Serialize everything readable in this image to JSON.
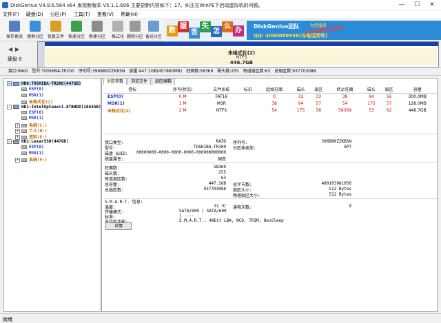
{
  "window": {
    "title": "DiskGenius V4.9.6.564 x64   发现新版本 V5.1.1.696 主要更新内容如下：17、纠正在WinPE下启动虚拟机的问题。",
    "min_glyph": "—",
    "max_glyph": "☐",
    "close_glyph": "✕"
  },
  "menu": [
    "文件(F)",
    "硬盘(D)",
    "分区(P)",
    "工具(T)",
    "查看(V)",
    "帮助(H)"
  ],
  "toolbar": [
    {
      "label": "保存更改",
      "color": "#5a7fc0"
    },
    {
      "label": "搜索分区",
      "color": "#3f8fd8"
    },
    {
      "label": "恢复文件",
      "color": "#d8a028"
    },
    {
      "label": "快速分区",
      "color": "#3aa04a"
    },
    {
      "label": "新建分区",
      "color": "#8c8c8c"
    },
    {
      "label": "格式化",
      "color": "#b0b0b0"
    },
    {
      "label": "删除分区",
      "color": "#9a9a9a"
    },
    {
      "label": "备份分区",
      "color": "#6a9ad0"
    }
  ],
  "banner": {
    "chars": [
      {
        "ch": "数",
        "color": "#e0a010"
      },
      {
        "ch": "据",
        "color": "#d03030"
      },
      {
        "ch": "丢",
        "color": "#3a8fd0"
      },
      {
        "ch": "失",
        "color": "#30a050"
      },
      {
        "ch": "怎",
        "color": "#2c6cc8"
      },
      {
        "ch": "么",
        "color": "#e07018"
      },
      {
        "ch": "办",
        "color": "#c0307a"
      }
    ],
    "brand": "DiskGenius团队",
    "slogan": "为您服务",
    "phone": "400-008-9958",
    "qq": "QQ: 4000089958(与电话同号)"
  },
  "diskmap": {
    "label": "硬盘 0",
    "left_arrow": "◀",
    "right_arrow": "▶",
    "partition_name": "未格式化(2)",
    "partition_fs": "NTFS",
    "partition_size": "446.7GB"
  },
  "infobar": {
    "items": [
      "接口:RAID",
      "型号:TOSHIBA-TR200",
      "序列号:396B80ZZKBSN",
      "容量:447.1GB(457860MB)",
      "柱面数:58369",
      "磁头数:255",
      "每道扇区数:63",
      "总扇区数:937703088"
    ]
  },
  "tree": [
    {
      "text": "HD0:TOSHIBA-TR200(447GB)",
      "type": "disk",
      "color": "",
      "sel": true,
      "exp": "−",
      "indent": 0
    },
    {
      "text": "ESP(0)",
      "type": "part",
      "color": "c-blue",
      "exp": "",
      "indent": 1
    },
    {
      "text": "MSR(1)",
      "type": "part",
      "color": "c-blue",
      "exp": "",
      "indent": 1
    },
    {
      "text": "未格式化(2)",
      "type": "part",
      "color": "c-orange",
      "exp": "",
      "indent": 1
    },
    {
      "text": "HD1:IntelOptane+1.8TBHDD(1863GB)",
      "type": "disk",
      "color": "",
      "exp": "−",
      "indent": 0
    },
    {
      "text": "ESP(0)",
      "type": "part",
      "color": "c-blue",
      "exp": "",
      "indent": 1
    },
    {
      "text": "MSR(1)",
      "type": "part",
      "color": "c-blue",
      "exp": "",
      "indent": 1
    },
    {
      "text": "系统(C:)",
      "type": "part",
      "color": "c-orange",
      "exp": "+",
      "indent": 1
    },
    {
      "text": "个人(H:)",
      "type": "part",
      "color": "c-orange",
      "exp": "+",
      "indent": 1
    },
    {
      "text": "资料(E:)",
      "type": "part",
      "color": "c-orange",
      "exp": "+",
      "indent": 1
    },
    {
      "text": "HD2:LexarSSD(447GB)",
      "type": "disk",
      "color": "",
      "exp": "−",
      "indent": 0
    },
    {
      "text": "ESP(0)",
      "type": "part",
      "color": "c-blue",
      "exp": "",
      "indent": 1
    },
    {
      "text": "MSR(1)",
      "type": "part",
      "color": "c-blue",
      "exp": "",
      "indent": 1
    },
    {
      "text": "系统(F:)",
      "type": "part",
      "color": "c-orange",
      "exp": "+",
      "indent": 1
    }
  ],
  "tabs": [
    "分区参数",
    "浏览文件",
    "扇区编辑"
  ],
  "partition_table": {
    "headers": [
      "卷标",
      "序号(状态)",
      "文件系统",
      "标识",
      "起始柱面",
      "磁头",
      "扇区",
      "终止柱面",
      "磁头",
      "扇区",
      "容量"
    ],
    "rows": [
      {
        "cells": [
          "ESP(0)",
          "0 M",
          "FAT16",
          "",
          "0",
          "32",
          "33",
          "38",
          "94",
          "56",
          "300.0MB"
        ],
        "cls": "row-blue"
      },
      {
        "cells": [
          "MSR(1)",
          "1 M",
          "MSR",
          "",
          "38",
          "94",
          "57",
          "54",
          "175",
          "57",
          "128.0MB"
        ],
        "cls": "row-blue"
      },
      {
        "cells": [
          "未格式化(2)",
          "2 M",
          "NTFS",
          "",
          "54",
          "175",
          "58",
          "58369",
          "53",
          "62",
          "446.7GB"
        ],
        "cls": "row-orange"
      }
    ]
  },
  "details": {
    "interface_label": "接口类型:",
    "interface": "RAID",
    "serial_label": "序列号:",
    "serial": "396B80ZZKBSN",
    "model_label": "型号:",
    "model": "TOSHIBA-TR200",
    "ptype_label": "分区表类型:",
    "ptype": "GPT",
    "guid_label": "磁盘 GUID:",
    "guid": "00000000-0000-0000-0000-000000000000",
    "attr_label": "磁盘属性:",
    "attr": "固态",
    "cyl_label": "柱面数:",
    "cyl": "58369",
    "heads_label": "磁头数:",
    "heads": "255",
    "spt_label": "每道扇区数:",
    "spt": "63",
    "cap_label": "总容量:",
    "cap": "447.1GB",
    "bytes_label": "总字节数:",
    "bytes": "480103981056",
    "sectors_label": "总扇区数:",
    "sectors": "937703088",
    "ssize_label": "扇区大小:",
    "ssize": "512 Bytes",
    "psize_label": "物理扇区大小:",
    "psize": "512 Bytes",
    "smart_label": "S.M.A.R.T. 信息:",
    "temp_label": "温度:",
    "temp": "31 ℃",
    "hours_label": "通电次数:",
    "hours": "9",
    "xfer_label": "传输模式:",
    "xfer": "SATA/600 | SATA/600",
    "std_label": "标准:",
    "std": "| ----",
    "feat_label": "支持的功能:",
    "feat": "S.M.A.R.T., 48bit LBA, NCQ, TRIM, DevSleep",
    "detail_button": "详情"
  },
  "status": "就绪"
}
